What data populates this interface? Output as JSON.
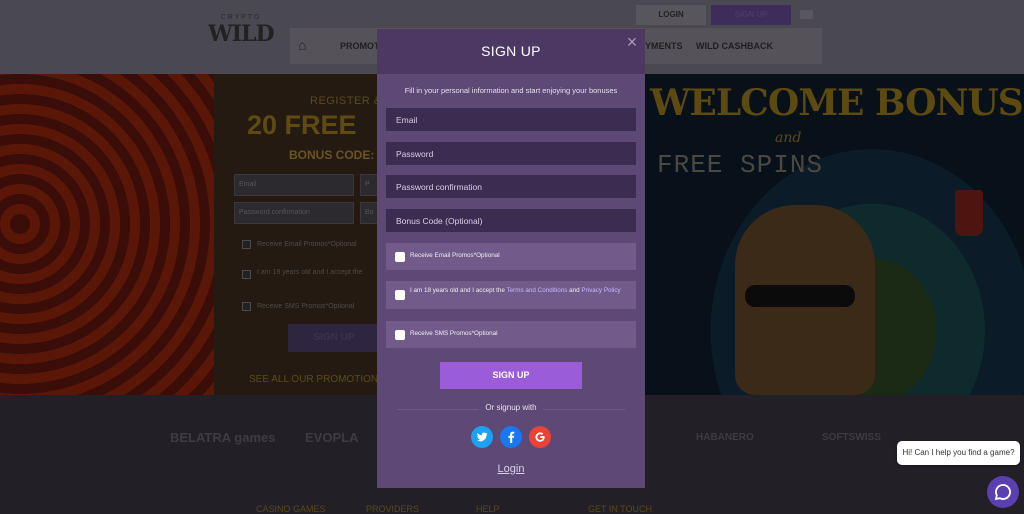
{
  "header": {
    "logo_top": "CRYPTO",
    "logo_text": "WILD",
    "login_label": "LOGIN",
    "signup_label": "SIGN UP",
    "nav_items": [
      "PROMOT",
      "YMENTS",
      "WILD CASHBACK"
    ]
  },
  "hero": {
    "register_text": "REGISTER &",
    "free_text": "20 FREE",
    "bonus_code": "BONUS CODE:",
    "bg_fields": [
      "Email",
      "P",
      "Password confirmation",
      "Bo"
    ],
    "bg_checks": [
      "Receive Email Promos*Optional",
      "I am 18 years old and I accept the",
      "Receive SMS Promos*Optional"
    ],
    "bg_signup": "SIGN UP",
    "see_promotions": "SEE ALL OUR PROMOTION",
    "welcome_bonus": "WELCOME BONUS",
    "and_text": "and",
    "free_spins": "FREE SPINS"
  },
  "footer": {
    "providers": [
      "BELATRA games",
      "EVOPLA",
      "HABANERO",
      "SOFTSWISS"
    ],
    "links": [
      "CASINO GAMES",
      "PROVIDERS",
      "HELP",
      "GET IN TOUCH"
    ]
  },
  "modal": {
    "title": "SIGN UP",
    "close_glyph": "×",
    "subtitle": "Fill in your personal information and start enjoying your bonuses",
    "fields": {
      "email_placeholder": "Email",
      "password_placeholder": "Password",
      "password_confirm_placeholder": "Password confirmation",
      "bonus_code_placeholder": "Bonus Code (Optional)"
    },
    "checks": {
      "email_promos": "Receive Email Promos",
      "email_promos_opt": "*Optional",
      "age_prefix": "I am 18 years old and I accept the ",
      "terms_link": "Terms and Conditions",
      "and_word": " and ",
      "privacy_link": "Privacy Policy",
      "sms_promos": "Receive SMS Promos",
      "sms_promos_opt": "*Optional"
    },
    "signup_button": "SIGN UP",
    "or_signup": "Or signup with",
    "socials": [
      "twitter-icon",
      "facebook-icon",
      "google-icon"
    ],
    "login_link": "Login"
  },
  "chat": {
    "prompt": "Hi! Can I help you find a game?"
  },
  "colors": {
    "modal_bg": "#5e4876",
    "modal_header": "#4d3863",
    "field_bg": "#3d2c52",
    "check_row_bg": "#725b8a",
    "accent": "#9a5cd8",
    "twitter": "#1da1f2",
    "facebook": "#1877f2",
    "google": "#ea4335"
  }
}
